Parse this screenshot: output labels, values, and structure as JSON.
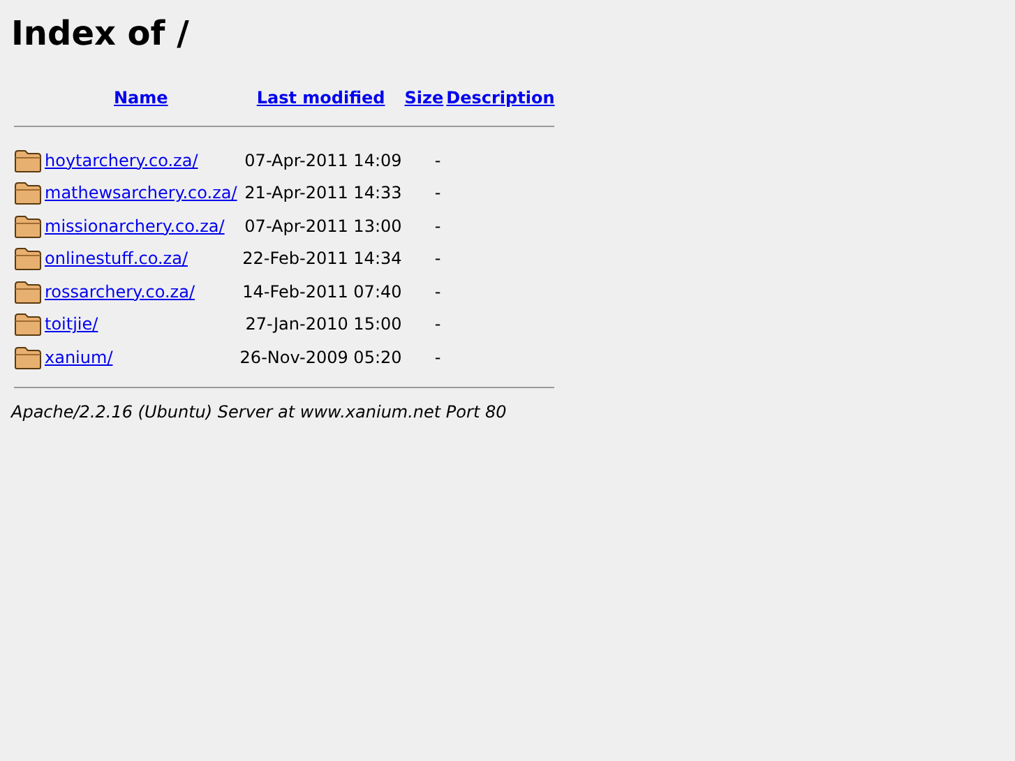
{
  "title": "Index of /",
  "columns": [
    "Name",
    "Last modified",
    "Size",
    "Description"
  ],
  "rows": [
    {
      "name": "hoytarchery.co.za/",
      "modified": "07-Apr-2011 14:09",
      "size": "-"
    },
    {
      "name": "mathewsarchery.co.za/",
      "modified": "21-Apr-2011 14:33",
      "size": "-"
    },
    {
      "name": "missionarchery.co.za/",
      "modified": "07-Apr-2011 13:00",
      "size": "-"
    },
    {
      "name": "onlinestuff.co.za/",
      "modified": "22-Feb-2011 14:34",
      "size": "-"
    },
    {
      "name": "rossarchery.co.za/",
      "modified": "14-Feb-2011 07:40",
      "size": "-"
    },
    {
      "name": "toitjie/",
      "modified": "27-Jan-2010 15:00",
      "size": "-"
    },
    {
      "name": "xanium/",
      "modified": "26-Nov-2009 05:20",
      "size": "-"
    }
  ],
  "footer": "Apache/2.2.16 (Ubuntu) Server at www.xanium.net Port 80"
}
